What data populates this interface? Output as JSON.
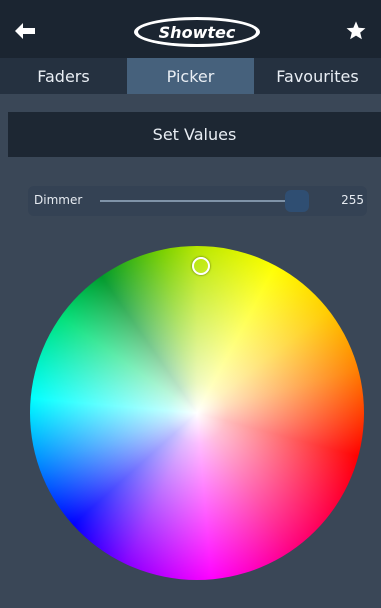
{
  "header": {
    "back_icon": "back-arrow-icon",
    "logo_text": "Showtec",
    "favorite_icon": "star-icon"
  },
  "tabs": [
    {
      "label": "Faders",
      "active": false
    },
    {
      "label": "Picker",
      "active": true
    },
    {
      "label": "Favourites",
      "active": false
    }
  ],
  "set_values_label": "Set Values",
  "dimmer": {
    "label": "Dimmer",
    "value": "255",
    "max": 255,
    "fraction": 1.0
  },
  "color_picker": {
    "selected_color_name": "yellow-green",
    "selected_color_hex": "#d8e800"
  },
  "colors": {
    "background": "#3a4757",
    "topbar": "#1b2531",
    "tabbar": "#253140",
    "active_tab": "#46617c",
    "set_values_bg": "#1d2733",
    "slider_thumb": "#2f4e72"
  }
}
